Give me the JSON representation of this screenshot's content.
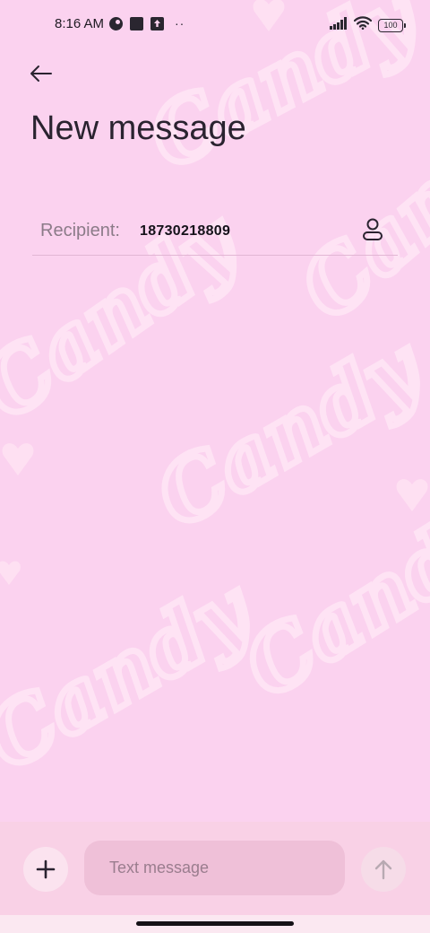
{
  "status_bar": {
    "time": "8:16 AM",
    "left_icons": [
      "data-saver-icon",
      "notification-square-icon",
      "upload-icon",
      "more-dots-icon"
    ],
    "more_dots": "··",
    "battery_level": "100",
    "right_icons": [
      "signal-icon",
      "wifi-icon",
      "battery-icon"
    ]
  },
  "header": {
    "back_icon": "arrow-left-icon",
    "title": "New message"
  },
  "recipient": {
    "label": "Recipient:",
    "value": "18730218809",
    "contact_icon": "person-icon"
  },
  "compose": {
    "add_icon": "plus-icon",
    "placeholder": "Text message",
    "value": "",
    "send_icon": "arrow-up-icon"
  },
  "wallpaper": {
    "word": "Candy"
  },
  "colors": {
    "background": "#fbd2ef",
    "compose_bar": "#f9d1e6",
    "input_fill": "#efc0d8",
    "text_primary": "#2a2330",
    "label_gray": "#8b7b88"
  }
}
